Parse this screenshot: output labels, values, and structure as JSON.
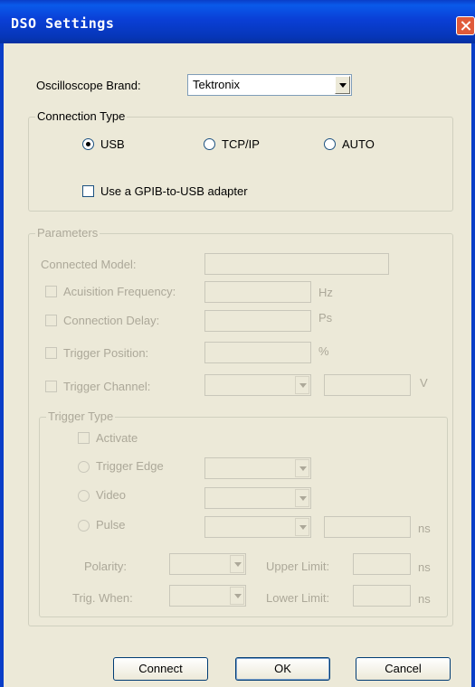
{
  "window": {
    "title": "DSO Settings"
  },
  "brand": {
    "label": "Oscilloscope Brand:",
    "value": "Tektronix"
  },
  "connection_type": {
    "legend": "Connection Type",
    "options": [
      {
        "label": "USB",
        "selected": true
      },
      {
        "label": "TCP/IP",
        "selected": false
      },
      {
        "label": "AUTO",
        "selected": false
      }
    ],
    "gpib_adapter": {
      "label": "Use a GPIB-to-USB adapter",
      "checked": false
    }
  },
  "parameters": {
    "legend": "Parameters",
    "connected_model": {
      "label": "Connected Model:",
      "value": ""
    },
    "acquisition_frequency": {
      "label": "Acuisition Frequency:",
      "unit": "Hz"
    },
    "connection_delay": {
      "label": "Connection Delay:",
      "unit": "Ps"
    },
    "trigger_position": {
      "label": "Trigger Position:",
      "unit": "%"
    },
    "trigger_channel": {
      "label": "Trigger Channel:",
      "unit": "V"
    },
    "trigger_type": {
      "legend": "Trigger Type",
      "activate": "Activate",
      "trigger_edge": "Trigger Edge",
      "video": "Video",
      "pulse": "Pulse",
      "pulse_unit": "ns",
      "polarity": "Polarity:",
      "trig_when": "Trig. When:",
      "upper_limit": "Upper Limit:",
      "lower_limit": "Lower Limit:",
      "upper_unit": "ns",
      "lower_unit": "ns"
    }
  },
  "buttons": {
    "connect": "Connect",
    "ok": "OK",
    "cancel": "Cancel"
  }
}
